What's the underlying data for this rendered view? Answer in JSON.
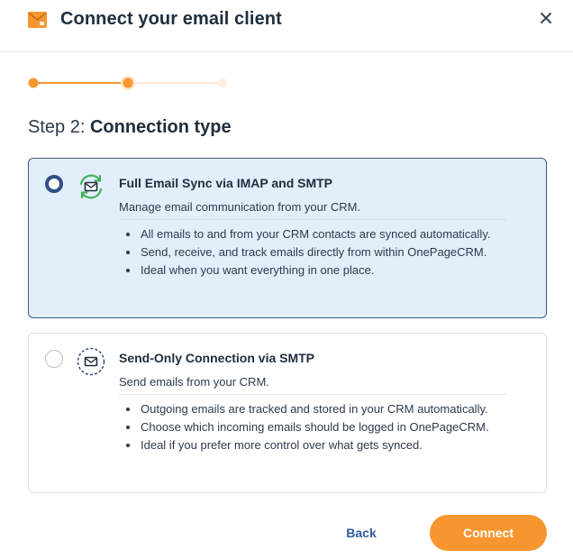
{
  "header": {
    "title": "Connect your email client",
    "logo_icon": "onepagecrm-logo-icon",
    "close_icon": "close-icon"
  },
  "stepper": {
    "total_steps": 3,
    "current_step": 2
  },
  "step": {
    "label": "Step 2:",
    "name": "Connection type"
  },
  "options": [
    {
      "selected": true,
      "icon": "sync-email-icon",
      "title": "Full Email Sync via IMAP and SMTP",
      "subtitle": "Manage email communication from your CRM.",
      "bullets": [
        "All emails to and from your CRM contacts are synced automatically.",
        "Send, receive, and track emails directly from within OnePageCRM.",
        "Ideal when you want everything in one place."
      ]
    },
    {
      "selected": false,
      "icon": "send-email-icon",
      "title": "Send-Only Connection via SMTP",
      "subtitle": "Send emails from your CRM.",
      "bullets": [
        "Outgoing emails are tracked and stored in your CRM automatically.",
        "Choose which incoming emails should be logged in OnePageCRM.",
        "Ideal if you prefer more control over what gets synced."
      ]
    }
  ],
  "footer": {
    "back_label": "Back",
    "connect_label": "Connect"
  },
  "colors": {
    "accent_orange": "#f7962f",
    "selected_border": "#3b5b91",
    "selected_bg": "#e3eefb",
    "link_blue": "#2f5b9b",
    "sync_green": "#43b35a"
  }
}
